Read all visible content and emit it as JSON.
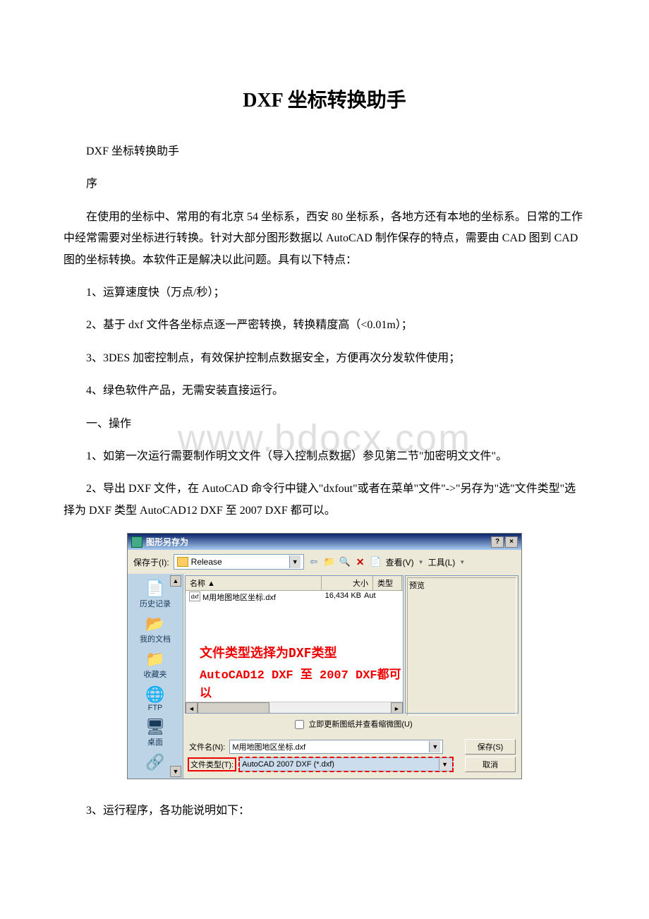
{
  "doc": {
    "title": "DXF 坐标转换助手",
    "p1": "DXF 坐标转换助手",
    "p2": "序",
    "p3": "在使用的坐标中、常用的有北京 54 坐标系，西安 80 坐标系，各地方还有本地的坐标系。日常的工作中经常需要对坐标进行转换。针对大部分图形数据以 AutoCAD 制作保存的特点，需要由 CAD 图到 CAD 图的坐标转换。本软件正是解决以此问题。具有以下特点：",
    "p4": "1、运算速度快（万点/秒）；",
    "p5": "2、基于 dxf 文件各坐标点逐一严密转换，转换精度高（<0.01m）；",
    "p6": "3、3DES 加密控制点，有效保护控制点数据安全，方便再次分发软件使用；",
    "p7": "4、绿色软件产品，无需安装直接运行。",
    "p8": "一、操作",
    "p9": "1、如第一次运行需要制作明文文件（导入控制点数据）参见第二节\"加密明文文件\"。",
    "p10": "2、导出 DXF 文件，在 AutoCAD 命令行中键入\"dxfout\"或者在菜单\"文件\"->\"另存为\"选\"文件类型\"选择为 DXF 类型 AutoCAD12 DXF 至 2007 DXF 都可以。",
    "p11": "3、运行程序，各功能说明如下：",
    "watermark": "www.bdocx.com"
  },
  "dialog": {
    "title": "图形另存为",
    "save_in_label": "保存于(I):",
    "folder": "Release",
    "view_label": "查看(V)",
    "tools_label": "工具(L)",
    "cols": {
      "name": "名称 ▲",
      "size": "大小",
      "type": "类型"
    },
    "file": {
      "name": "M用地图地区坐标.dxf",
      "size": "16,434 KB",
      "type": "Aut"
    },
    "overlay1": "文件类型选择为DXF类型",
    "overlay2": "AutoCAD12 DXF 至 2007 DXF都可以",
    "preview_label": "预览",
    "checkbox_label": "立即更新图纸并查看缩微图(U)",
    "filename_label": "文件名(N):",
    "filename_value": "M用地图地区坐标.dxf",
    "filetype_label": "文件类型(T):",
    "filetype_value": "AutoCAD 2007 DXF (*.dxf)",
    "save_btn": "保存(S)",
    "cancel_btn": "取消",
    "sidebar": {
      "history": "历史记录",
      "mydocs": "我的文档",
      "favorites": "收藏夹",
      "ftp": "FTP",
      "desktop": "桌面"
    }
  }
}
